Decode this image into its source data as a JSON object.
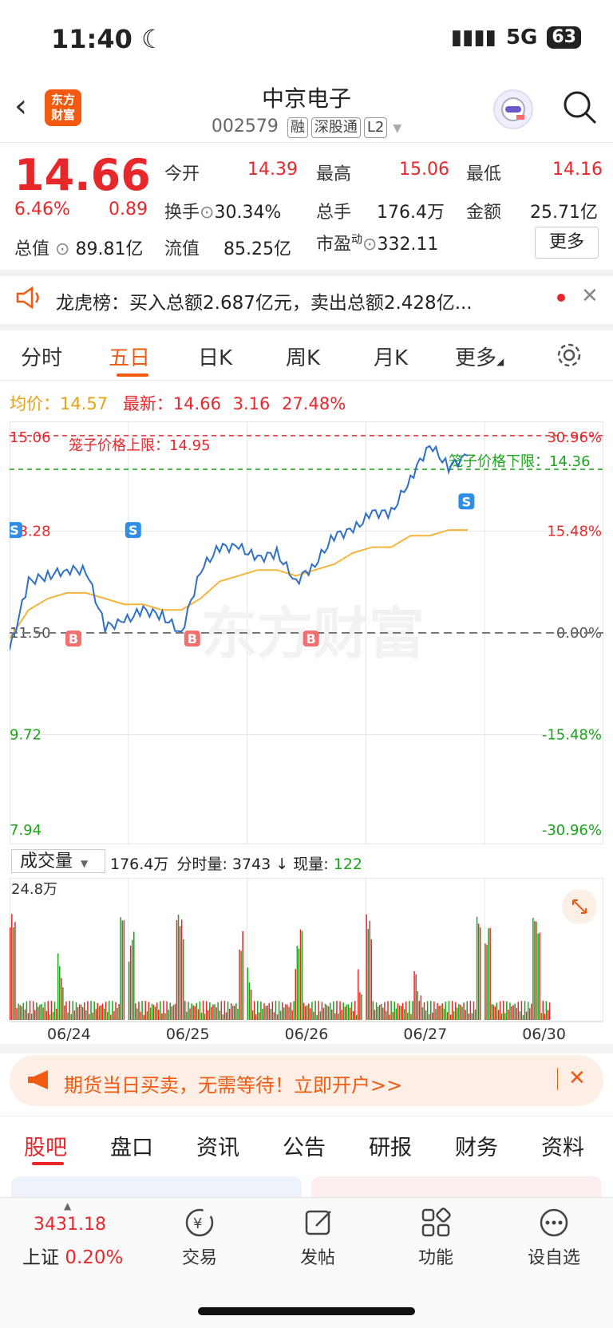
{
  "status": {
    "time": "11:40",
    "network": "5G",
    "battery": "63"
  },
  "header": {
    "name": "中京电子",
    "code": "002579",
    "tags": [
      "融",
      "深股通",
      "L2"
    ],
    "logo_text": "东方财富"
  },
  "quote": {
    "price": "14.66",
    "change_pct": "6.46%",
    "change": "0.89",
    "open_label": "今开",
    "open": "14.39",
    "high_label": "最高",
    "high": "15.06",
    "low_label": "最低",
    "low": "14.16",
    "turnover_label": "换手",
    "turnover": "30.34%",
    "volume_label": "总手",
    "volume": "176.4万",
    "amount_label": "金额",
    "amount": "25.71亿",
    "mcap_label": "总值",
    "mcap": "89.81亿",
    "float_label": "流值",
    "float": "85.25亿",
    "pe_label": "市盈",
    "pe_sup": "动",
    "pe": "332.11",
    "more_button": "更多"
  },
  "notice": {
    "text": "龙虎榜：买入总额2.687亿元，卖出总额2.428亿..."
  },
  "tabs": [
    "分时",
    "五日",
    "日K",
    "周K",
    "月K",
    "更多"
  ],
  "active_tab": 1,
  "info_line": {
    "avg_label": "均价：",
    "avg": "14.57",
    "latest_label": "最新：",
    "latest": "14.66",
    "change": "3.16",
    "pct": "27.48%"
  },
  "chart_data": {
    "type": "line",
    "x": [
      "06/24",
      "06/25",
      "06/26",
      "06/27",
      "06/30"
    ],
    "y_ticks_left": [
      "15.06",
      "13.28",
      "11.50",
      "9.72",
      "7.94"
    ],
    "y_ticks_right": [
      "30.96%",
      "15.48%",
      "0.00%",
      "-15.48%",
      "-30.96%"
    ],
    "ylim": [
      7.94,
      15.06
    ],
    "baseline": 11.5,
    "upper_cage_label": "笼子价格上限：14.95",
    "lower_cage_label": "笼子价格下限：14.36",
    "upper_cage": 14.95,
    "lower_cage": 14.36,
    "series": [
      {
        "name": "最新",
        "values": [
          11.2,
          12.4,
          12.5,
          12.6,
          12.6,
          11.6,
          11.7,
          11.9,
          11.8,
          11.5,
          12.6,
          13.0,
          13.0,
          12.8,
          12.9,
          12.4,
          12.7,
          13.2,
          13.3,
          13.6,
          13.6,
          14.2,
          14.8,
          14.4,
          14.6
        ]
      },
      {
        "name": "均价",
        "values": [
          11.4,
          11.9,
          12.1,
          12.2,
          12.2,
          12.1,
          12.0,
          12.0,
          11.9,
          11.9,
          12.1,
          12.4,
          12.5,
          12.6,
          12.6,
          12.5,
          12.6,
          12.7,
          12.9,
          13.0,
          13.0,
          13.2,
          13.2,
          13.3,
          13.3
        ]
      }
    ],
    "markers": [
      {
        "label": "S",
        "day": 0
      },
      {
        "label": "B",
        "day": 0
      },
      {
        "label": "S",
        "day": 1
      },
      {
        "label": "B",
        "day": 1
      },
      {
        "label": "B",
        "day": 2
      },
      {
        "label": "S",
        "day": 3
      }
    ],
    "watermark": "东方财富"
  },
  "volume": {
    "label": "成交量",
    "total": "176.4万",
    "tick_label": "分时量:",
    "tick": "3743",
    "now_label": "现量:",
    "now": "122",
    "ymax": "24.8万"
  },
  "banner": {
    "text": "期货当日买卖，无需等待！立即开户>>"
  },
  "bottom_tabs": [
    "股吧",
    "盘口",
    "资讯",
    "公告",
    "研报",
    "财务",
    "资料"
  ],
  "nav": {
    "index_value": "3431.18",
    "index_name": "上证",
    "index_pct": "0.20%",
    "items": [
      "交易",
      "发帖",
      "功能",
      "设自选"
    ]
  }
}
